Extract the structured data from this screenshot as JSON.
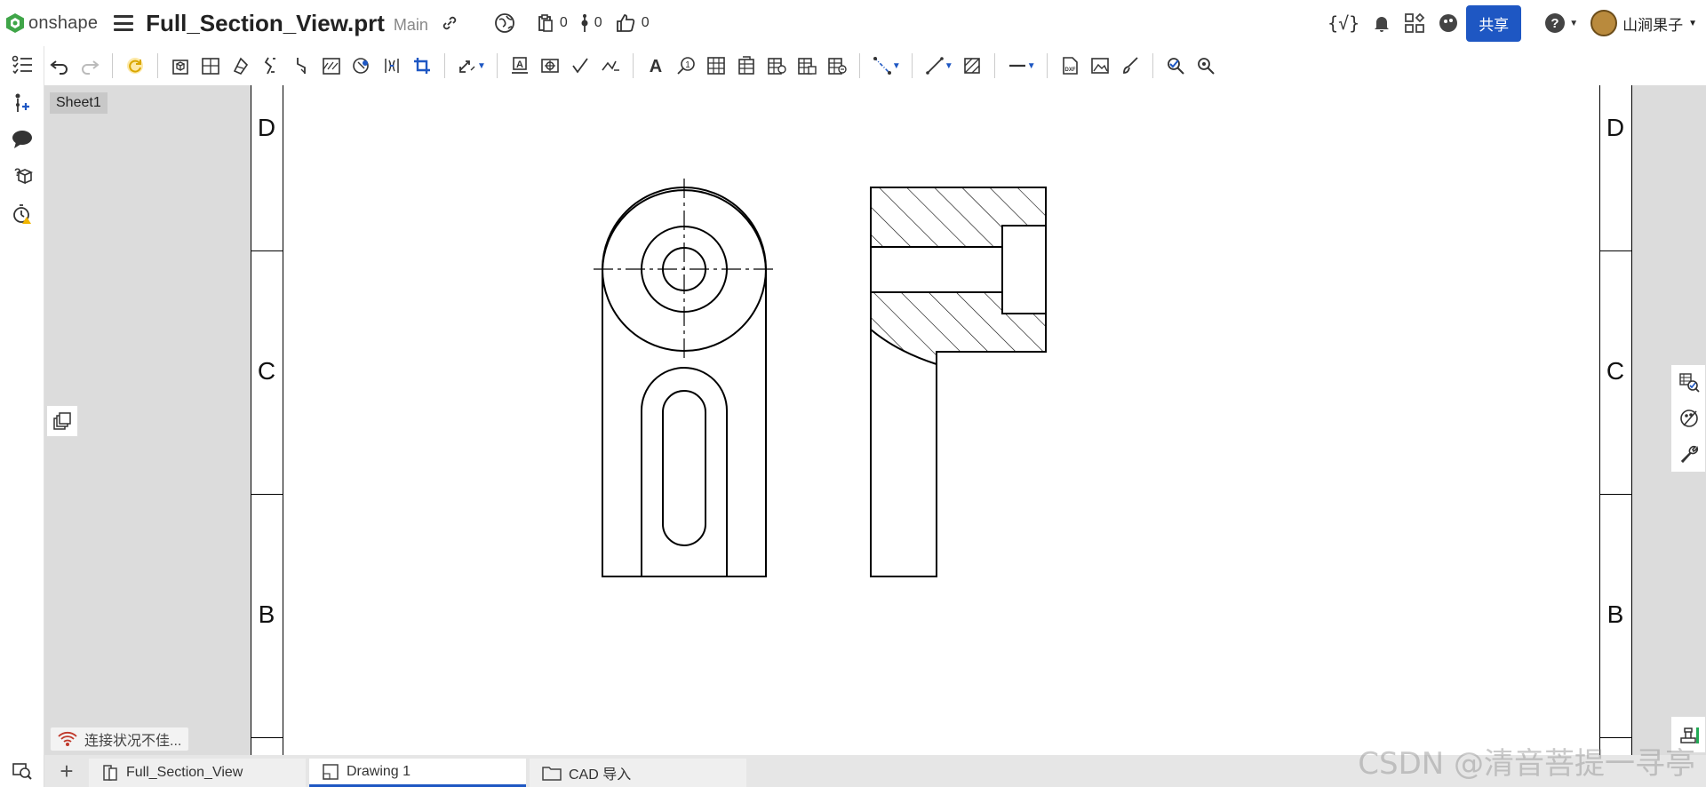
{
  "app": {
    "logo_text": "onshape"
  },
  "document": {
    "title": "Full_Section_View.prt",
    "branch": "Main"
  },
  "counters": {
    "clipboard": "0",
    "versions": "0",
    "likes": "0"
  },
  "header": {
    "share_label": "共享",
    "user_name": "山涧果子"
  },
  "sheet": {
    "name": "Sheet1"
  },
  "zones": {
    "top": "D",
    "middle": "C",
    "lower": "B"
  },
  "status": {
    "connection_text": "连接状况不佳..."
  },
  "tabs": [
    {
      "label": "Full_Section_View"
    },
    {
      "label": "Drawing 1"
    },
    {
      "label": "CAD 导入"
    }
  ],
  "watermark": "CSDN @清音菩提一寻亭",
  "colors": {
    "accent": "#1e57c3",
    "canvas": "#dcdcdc",
    "logo_green": "#3fa548"
  }
}
